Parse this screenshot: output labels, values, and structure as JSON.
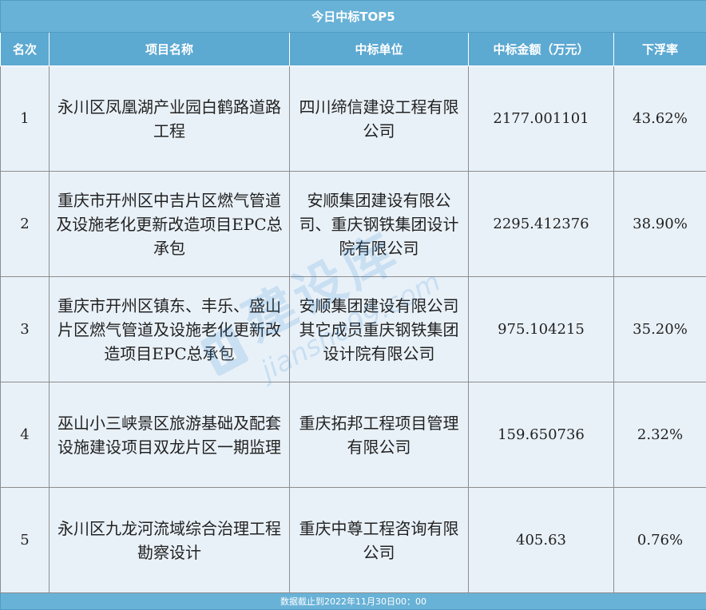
{
  "title": "今日中标TOP5",
  "headers": {
    "rank": "名次",
    "project": "项目名称",
    "company": "中标单位",
    "amount": "中标金额（万元）",
    "rate": "下浮率"
  },
  "rows": [
    {
      "rank": "1",
      "project": "永川区凤凰湖产业园白鹤路道路工程",
      "company": "四川缔信建设工程有限公司",
      "amount": "2177.001101",
      "rate": "43.62%"
    },
    {
      "rank": "2",
      "project": "重庆市开州区中吉片区燃气管道及设施老化更新改造项目EPC总承包",
      "company": "安顺集团建设有限公司、重庆钢铁集团设计院有限公司",
      "amount": "2295.412376",
      "rate": "38.90%"
    },
    {
      "rank": "3",
      "project": "重庆市开州区镇东、丰乐、盛山片区燃气管道及设施老化更新改造项目EPC总承包",
      "company": "安顺集团建设有限公司其它成员重庆钢铁集团设计院有限公司",
      "amount": "975.104215",
      "rate": "35.20%"
    },
    {
      "rank": "4",
      "project": "巫山小三峡景区旅游基础及配套设施建设项目双龙片区一期监理",
      "company": "重庆拓邦工程项目管理有限公司",
      "amount": "159.650736",
      "rate": "2.32%"
    },
    {
      "rank": "5",
      "project": "永川区九龙河流域综合治理工程勘察设计",
      "company": "重庆中尊工程咨询有限公司",
      "amount": "405.63",
      "rate": "0.76%"
    }
  ],
  "footer": "数据截止到2022年11月30日00：00",
  "watermark": {
    "text_cn": "建设库",
    "text_en": "jianshe99.com"
  }
}
